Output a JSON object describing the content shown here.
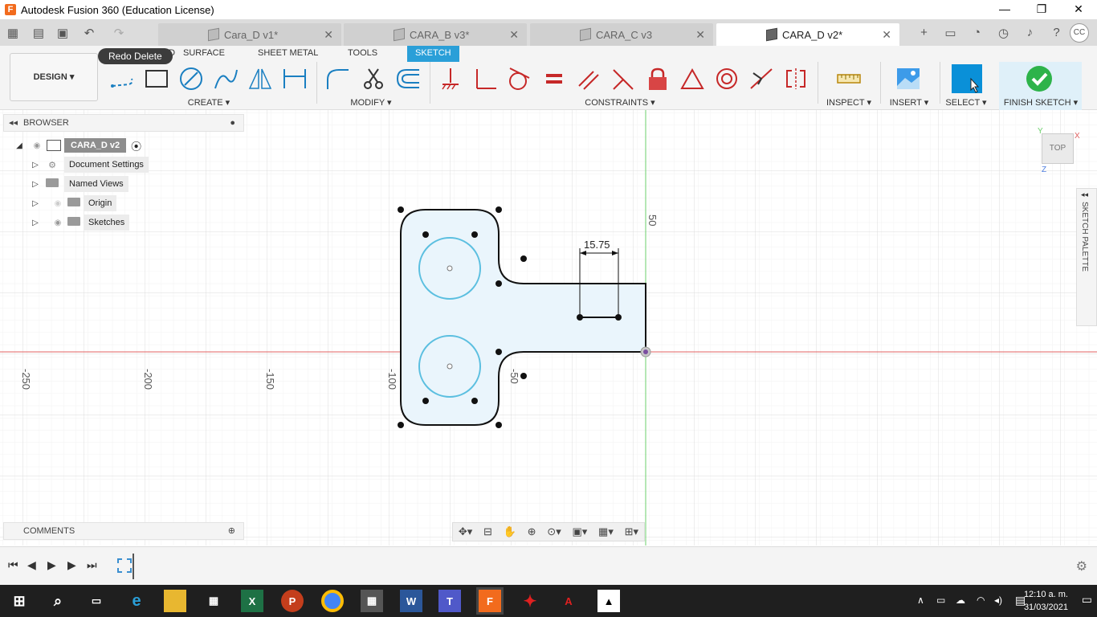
{
  "window": {
    "title": "Autodesk Fusion 360 (Education License)",
    "min": "—",
    "max": "❐",
    "close": "✕"
  },
  "tabs": [
    {
      "label": "Cara_D v1*"
    },
    {
      "label": "CARA_B v3*"
    },
    {
      "label": "CARA_C v3"
    },
    {
      "label": "CARA_D v2*"
    }
  ],
  "user_initials": "CC",
  "ribbon": {
    "workspace": "DESIGN ▾",
    "tooltip": "Redo Delete",
    "tabs": [
      "SOLID",
      "SURFACE",
      "SHEET METAL",
      "TOOLS",
      "SKETCH"
    ],
    "groups": {
      "create": "CREATE ▾",
      "modify": "MODIFY ▾",
      "constraints": "CONSTRAINTS ▾",
      "inspect": "INSPECT ▾",
      "insert": "INSERT ▾",
      "select": "SELECT ▾",
      "finish": "FINISH SKETCH ▾"
    }
  },
  "browser": {
    "title": "BROWSER",
    "root": "CARA_D v2",
    "items": [
      "Document Settings",
      "Named Views",
      "Origin",
      "Sketches"
    ]
  },
  "comments": {
    "title": "COMMENTS"
  },
  "sketch_palette": {
    "label": "SKETCH PALETTE"
  },
  "viewcube": {
    "face": "TOP",
    "x": "X",
    "y": "Y",
    "z": "Z"
  },
  "canvas": {
    "dimension": "15.75",
    "axis_labels": [
      "-250",
      "-200",
      "-150",
      "-100",
      "-50",
      "50"
    ]
  },
  "taskbar": {
    "time": "12:10 a. m.",
    "date": "31/03/2021"
  },
  "colors": {
    "accent": "#2a9fd8",
    "finish": "#2db34a",
    "sketch_fill": "#eaf5fc",
    "circle": "#5bbfe0"
  }
}
